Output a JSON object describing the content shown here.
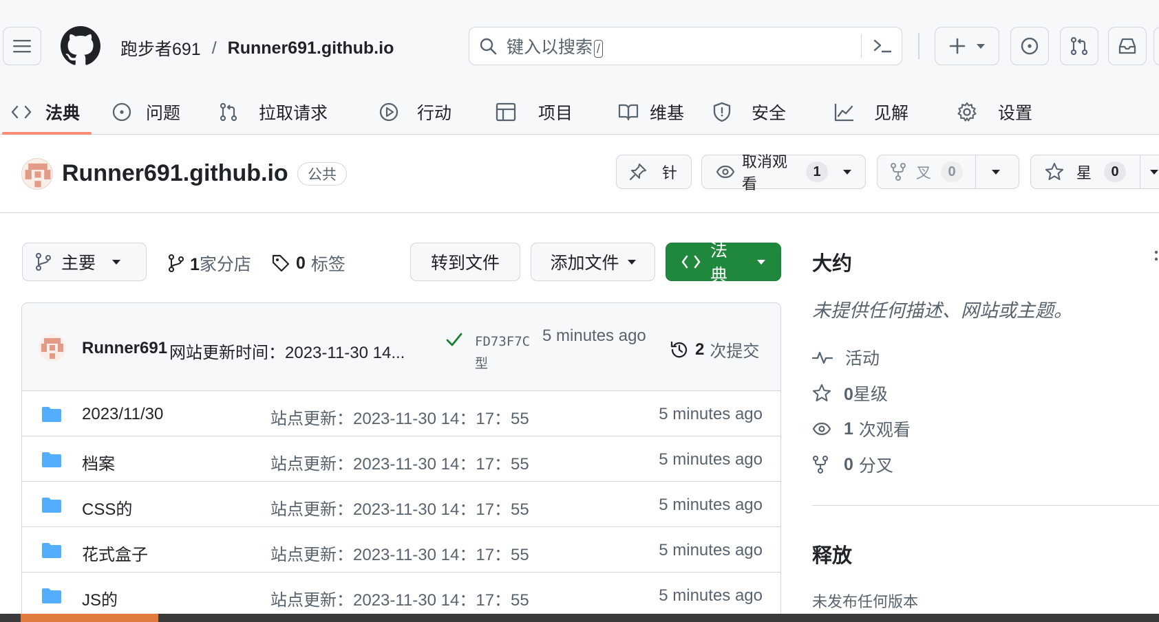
{
  "header": {
    "owner": "跑步者691",
    "separator": "/",
    "repo": "Runner691.github.io",
    "search_placeholder": "键入以搜索",
    "search_key": "/"
  },
  "tabs": [
    {
      "label": "法典",
      "icon": "code-icon",
      "active": true
    },
    {
      "label": "问题",
      "icon": "issue-icon"
    },
    {
      "label": "拉取请求",
      "icon": "pull-request-icon"
    },
    {
      "label": "行动",
      "icon": "play-icon"
    },
    {
      "label": "项目",
      "icon": "table-icon"
    },
    {
      "label": "维基",
      "icon": "book-icon"
    },
    {
      "label": "安全",
      "icon": "shield-icon"
    },
    {
      "label": "见解",
      "icon": "graph-icon"
    },
    {
      "label": "设置",
      "icon": "gear-icon"
    }
  ],
  "repo_header": {
    "name": "Runner691.github.io",
    "visibility": "公共",
    "pin_label": "针",
    "watch_label": "取消观看",
    "watch_count": "1",
    "fork_label": "叉",
    "fork_count": "0",
    "star_label": "星",
    "star_count": "0"
  },
  "toolbar": {
    "branch": "主要",
    "branches_count": "1",
    "branches_label": "家分店",
    "tags_count": "0",
    "tags_label": "标签",
    "goto_file": "转到文件",
    "add_file": "添加文件",
    "code_label": "法典"
  },
  "commit": {
    "author": "Runner691",
    "message": "网站更新时间：2023-11-30 14...",
    "sha": "FD73F7C型",
    "time": "5 minutes ago",
    "count": "2",
    "count_label": "次提交"
  },
  "files": [
    {
      "name": "2023/11/30",
      "message": "站点更新：2023-11-30 14：17：55",
      "time": "5 minutes ago"
    },
    {
      "name": "档案",
      "message": "站点更新：2023-11-30 14：17：55",
      "time": "5 minutes ago"
    },
    {
      "name": "CSS的",
      "message": "站点更新：2023-11-30 14：17：55",
      "time": "5 minutes ago"
    },
    {
      "name": "花式盒子",
      "message": "站点更新：2023-11-30 14：17：55",
      "time": "5 minutes ago"
    },
    {
      "name": "JS的",
      "message": "站点更新：2023-11-30 14：17：55",
      "time": "5 minutes ago"
    }
  ],
  "sidebar": {
    "about_title": "大约",
    "description": "未提供任何描述、网站或主题。",
    "activity": "活动",
    "stars_count": "0",
    "stars_label": "星级",
    "watching_count": "1",
    "watching_label": "次观看",
    "forks_count": "0",
    "forks_label": "分叉",
    "releases_title": "释放",
    "no_releases": "未发布任何版本"
  },
  "colors": {
    "accent_underline": "#fd8c73",
    "primary_green": "#1f883d",
    "folder_blue": "#54aeff",
    "check_green": "#1a7f37",
    "muted_text": "#59636e",
    "border": "#d0d7de"
  }
}
